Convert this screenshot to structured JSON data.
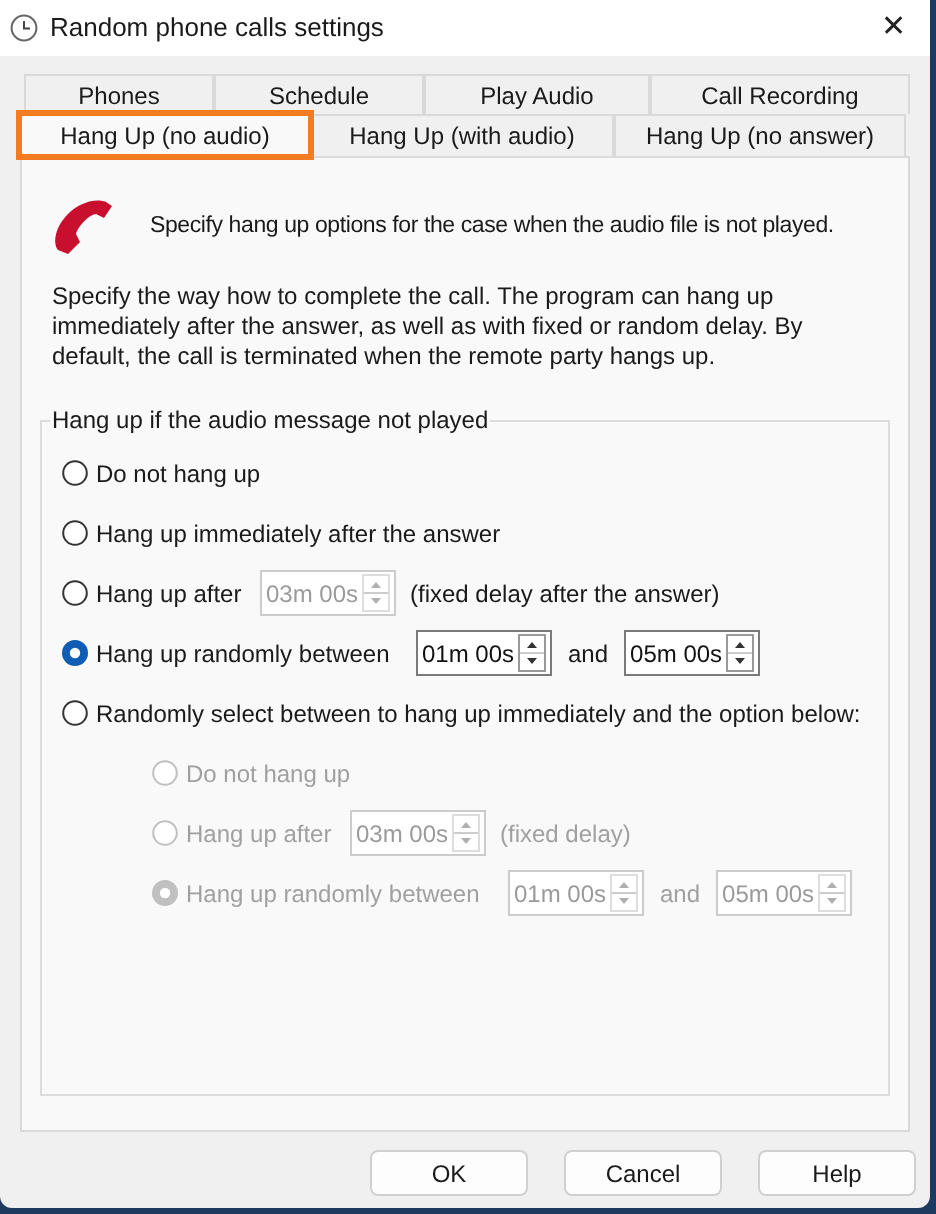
{
  "window": {
    "title": "Random phone calls settings",
    "close": "✕"
  },
  "tab_rows": [
    [
      {
        "label": "Phones",
        "selected": false,
        "highlighted": false
      },
      {
        "label": "Schedule",
        "selected": false,
        "highlighted": false
      },
      {
        "label": "Play Audio",
        "selected": false,
        "highlighted": false
      },
      {
        "label": "Call Recording",
        "selected": false,
        "highlighted": false
      }
    ],
    [
      {
        "label": "Hang Up (no audio)",
        "selected": true,
        "highlighted": true
      },
      {
        "label": "Hang Up (with audio)",
        "selected": false,
        "highlighted": false
      },
      {
        "label": "Hang Up (no answer)",
        "selected": false,
        "highlighted": false
      }
    ]
  ],
  "header": "Specify hang up options for the case when the audio file is not played.",
  "description": "Specify the way how to complete the call. The program can hang up immediately after the answer, as well as with fixed or random delay. By default, the call is terminated when the remote party hangs up.",
  "group": {
    "title": "Hang up if the audio message not played",
    "options": [
      {
        "kind": "plain",
        "label": "Do not hang up",
        "selected": false,
        "disabled": false
      },
      {
        "kind": "plain",
        "label": "Hang up immediately after the answer",
        "selected": false,
        "disabled": false
      },
      {
        "kind": "fixed",
        "label": "Hang up after",
        "selected": false,
        "disabled": false,
        "spins": [
          {
            "value": "03m 00s",
            "disabled": true
          }
        ],
        "note": "(fixed delay after the answer)"
      },
      {
        "kind": "range",
        "label": "Hang up randomly between",
        "selected": true,
        "disabled": false,
        "spins": [
          {
            "value": "01m 00s",
            "disabled": false
          },
          {
            "value": "05m 00s",
            "disabled": false
          }
        ],
        "joiner": "and"
      },
      {
        "kind": "plain",
        "label": "Randomly select between to hang up immediately and the option below:",
        "selected": false,
        "disabled": false,
        "children": [
          {
            "kind": "plain",
            "label": "Do not hang up",
            "selected": false,
            "disabled": true
          },
          {
            "kind": "fixed",
            "label": "Hang up after",
            "selected": false,
            "disabled": true,
            "spins": [
              {
                "value": "03m 00s",
                "disabled": true
              }
            ],
            "note": "(fixed delay)"
          },
          {
            "kind": "range",
            "label": "Hang up randomly between",
            "selected": true,
            "disabled": true,
            "spins": [
              {
                "value": "01m 00s",
                "disabled": true
              },
              {
                "value": "05m 00s",
                "disabled": true
              }
            ],
            "joiner": "and"
          }
        ]
      }
    ]
  },
  "buttons": [
    "OK",
    "Cancel",
    "Help"
  ]
}
